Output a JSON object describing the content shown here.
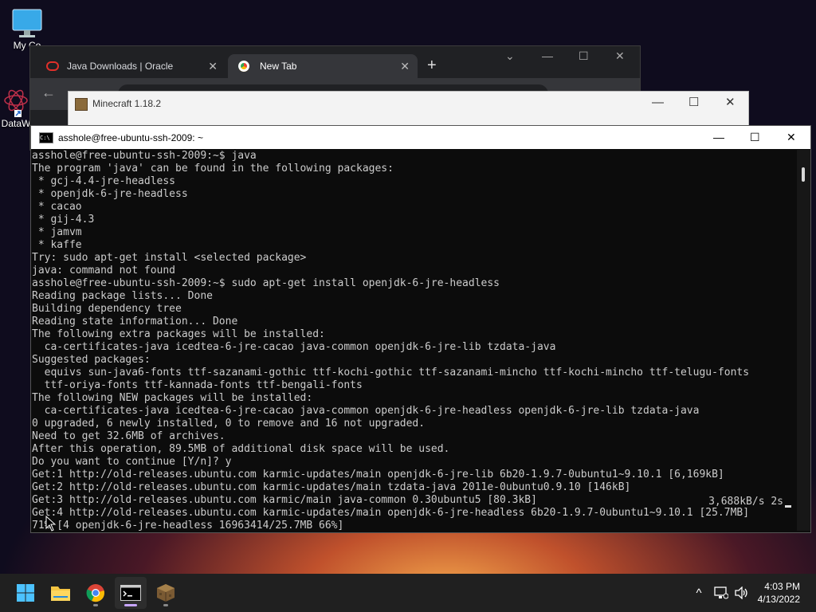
{
  "desktop": {
    "icons": [
      {
        "label": "My Co",
        "icon": "monitor-icon"
      },
      {
        "label": "DataW",
        "icon": "atom-icon"
      }
    ]
  },
  "chrome": {
    "tabs": [
      {
        "label": "Java Downloads | Oracle",
        "icon": "oracle-icon",
        "active": false
      },
      {
        "label": "New Tab",
        "icon": "chrome-icon",
        "active": true
      }
    ],
    "new_tab": "+"
  },
  "minecraft": {
    "title": "Minecraft 1.18.2"
  },
  "terminal": {
    "title": "asshole@free-ubuntu-ssh-2009: ~",
    "lines": [
      "asshole@free-ubuntu-ssh-2009:~$ java",
      "The program 'java' can be found in the following packages:",
      " * gcj-4.4-jre-headless",
      " * openjdk-6-jre-headless",
      " * cacao",
      " * gij-4.3",
      " * jamvm",
      " * kaffe",
      "Try: sudo apt-get install <selected package>",
      "java: command not found",
      "asshole@free-ubuntu-ssh-2009:~$ sudo apt-get install openjdk-6-jre-headless",
      "Reading package lists... Done",
      "Building dependency tree",
      "Reading state information... Done",
      "The following extra packages will be installed:",
      "  ca-certificates-java icedtea-6-jre-cacao java-common openjdk-6-jre-lib tzdata-java",
      "Suggested packages:",
      "  equivs sun-java6-fonts ttf-sazanami-gothic ttf-kochi-gothic ttf-sazanami-mincho ttf-kochi-mincho ttf-telugu-fonts",
      "  ttf-oriya-fonts ttf-kannada-fonts ttf-bengali-fonts",
      "The following NEW packages will be installed:",
      "  ca-certificates-java icedtea-6-jre-cacao java-common openjdk-6-jre-headless openjdk-6-jre-lib tzdata-java",
      "0 upgraded, 6 newly installed, 0 to remove and 16 not upgraded.",
      "Need to get 32.6MB of archives.",
      "After this operation, 89.5MB of additional disk space will be used.",
      "Do you want to continue [Y/n]? y",
      "Get:1 http://old-releases.ubuntu.com karmic-updates/main openjdk-6-jre-lib 6b20-1.9.7-0ubuntu1~9.10.1 [6,169kB]",
      "Get:2 http://old-releases.ubuntu.com karmic-updates/main tzdata-java 2011e-0ubuntu0.9.10 [146kB]",
      "Get:3 http://old-releases.ubuntu.com karmic/main java-common 0.30ubuntu5 [80.3kB]",
      "Get:4 http://old-releases.ubuntu.com karmic-updates/main openjdk-6-jre-headless 6b20-1.9.7-0ubuntu1~9.10.1 [25.7MB]",
      "71% [4 openjdk-6-jre-headless 16963414/25.7MB 66%]"
    ],
    "progress_right": "3,688kB/s 2s"
  },
  "taskbar": {
    "apps": [
      {
        "name": "start-button",
        "icon": "windows-icon"
      },
      {
        "name": "file-explorer-button",
        "icon": "folder-icon"
      },
      {
        "name": "chrome-button",
        "icon": "chrome-icon"
      },
      {
        "name": "terminal-button",
        "icon": "terminal-icon"
      },
      {
        "name": "minecraft-button",
        "icon": "minecraft-icon"
      }
    ],
    "tray": {
      "chevron": "^"
    },
    "clock": {
      "time": "4:03 PM",
      "date": "4/13/2022"
    }
  }
}
